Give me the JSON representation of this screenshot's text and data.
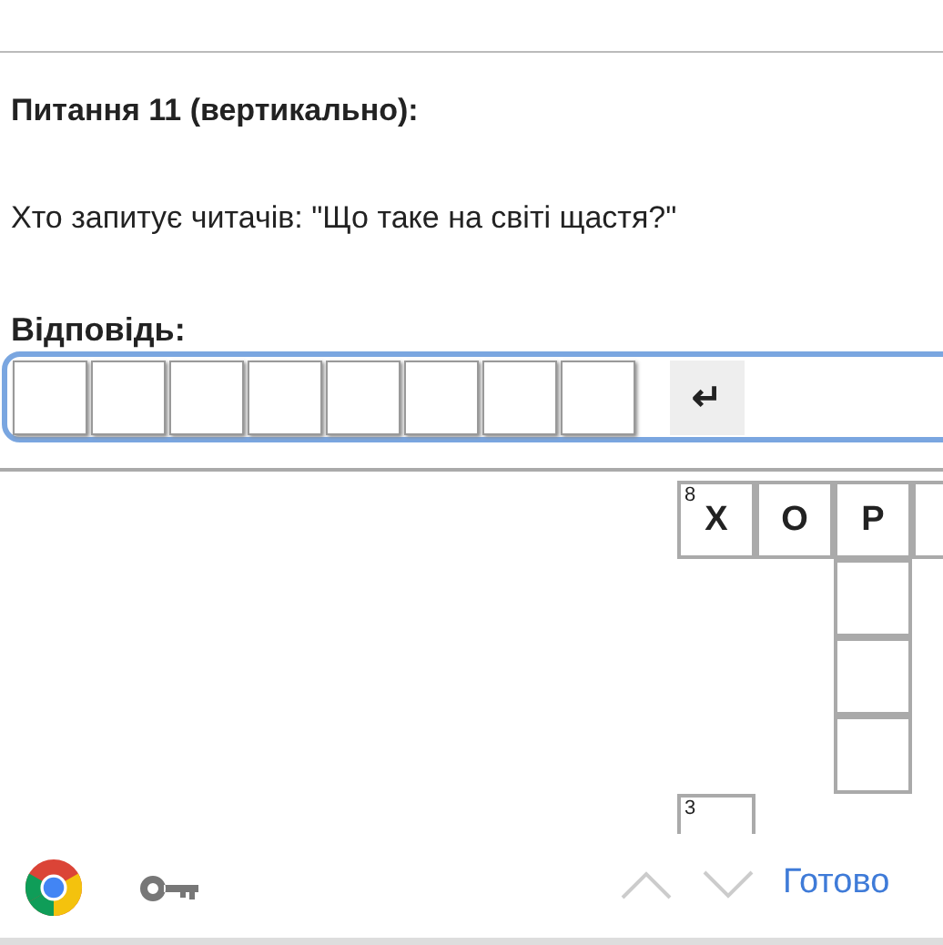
{
  "question": {
    "title": "Питання 11 (вертикально):",
    "text": "Хто запитує читачів: \"Що таке на світі щастя?\"",
    "answer_label": "Відповідь:",
    "cells": [
      {
        "filled": false
      },
      {
        "filled": false
      },
      {
        "filled": false
      },
      {
        "filled": false
      },
      {
        "filled": false
      },
      {
        "filled": false
      },
      {
        "filled": false
      },
      {
        "filled": false
      }
    ],
    "enter_key": "↵"
  },
  "grid": [
    [
      {
        "kind": "cell",
        "number": "8",
        "letter": "Х"
      },
      {
        "kind": "cell",
        "letter": "О"
      },
      {
        "kind": "cell",
        "letter": "Р"
      },
      {
        "kind": "cell"
      }
    ],
    [
      {
        "kind": "blank"
      },
      {
        "kind": "blank"
      },
      {
        "kind": "cell"
      }
    ],
    [
      {
        "kind": "blank"
      },
      {
        "kind": "blank"
      },
      {
        "kind": "cell"
      }
    ],
    [
      {
        "kind": "blank"
      },
      {
        "kind": "blank"
      },
      {
        "kind": "cell"
      }
    ],
    [
      {
        "kind": "cell",
        "number": "3"
      }
    ]
  ],
  "keyboard_bar": {
    "prev_disabled": true,
    "next_disabled": true,
    "done": "Готово"
  }
}
